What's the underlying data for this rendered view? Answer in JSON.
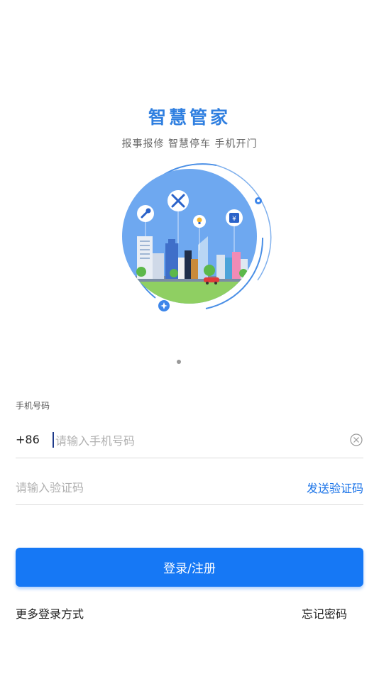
{
  "header": {
    "title": "智慧管家",
    "subtitle": "报事报修 智慧停车 手机开门"
  },
  "colors": {
    "accent": "#1678f5",
    "link": "#1a73e8",
    "title": "#2f7fe0"
  },
  "illustration": {
    "icons": [
      "wrench-icon",
      "tools-icon",
      "lightbulb-icon",
      "yuan-icon"
    ]
  },
  "carousel": {
    "page_count": 1,
    "current": 1
  },
  "form": {
    "phone_label": "手机号码",
    "country_code": "+86",
    "phone_placeholder": "请输入手机号码",
    "phone_value": "",
    "code_placeholder": "请输入验证码",
    "code_value": "",
    "send_code_label": "发送验证码"
  },
  "actions": {
    "login_label": "登录/注册",
    "more_login_label": "更多登录方式",
    "forgot_password_label": "忘记密码"
  }
}
